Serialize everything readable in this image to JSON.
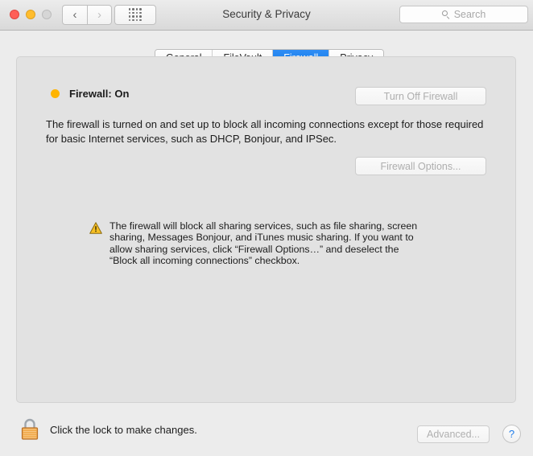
{
  "window": {
    "title": "Security & Privacy",
    "traffic_lights": [
      "close",
      "minimize",
      "zoom"
    ],
    "nav": {
      "back_icon": "chevron-left-icon",
      "forward_icon": "chevron-right-icon",
      "show_all_icon": "grid-dots-icon"
    },
    "search": {
      "placeholder": "Search",
      "value": "",
      "icon": "search-icon"
    }
  },
  "tabs": [
    {
      "label": "General",
      "active": false
    },
    {
      "label": "FileVault",
      "active": false
    },
    {
      "label": "Firewall",
      "active": true
    },
    {
      "label": "Privacy",
      "active": false
    }
  ],
  "firewall": {
    "status_label": "Firewall: On",
    "status_dot_color": "#ffb400",
    "turn_off_button": "Turn Off Firewall",
    "options_button": "Firewall Options...",
    "description": "The firewall is turned on and set up to block all incoming connections except for those required for basic Internet services, such as DHCP, Bonjour, and IPSec.",
    "warning_icon": "warning-triangle-icon",
    "warning_text": "The firewall will block all sharing services, such as file sharing, screen sharing, Messages Bonjour, and iTunes music sharing.  If you want to allow sharing services, click “Firewall Options…” and deselect the “Block all incoming connections” checkbox."
  },
  "footer": {
    "lock_icon": "lock-closed-icon",
    "lock_text": "Click the lock to make changes.",
    "advanced_button": "Advanced...",
    "help_button": "?"
  },
  "colors": {
    "accent": "#1379e8",
    "status_amber": "#ffb400",
    "window_bg": "#ececec",
    "panel_bg": "#e2e2e2"
  }
}
